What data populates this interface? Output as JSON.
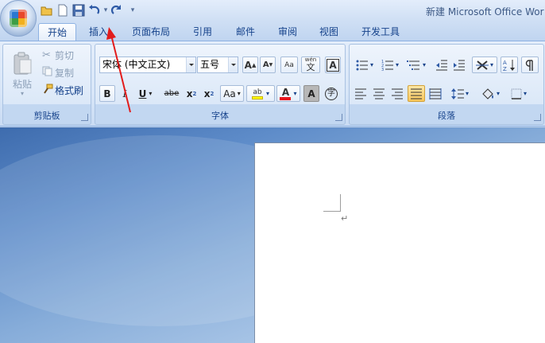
{
  "window": {
    "title": "新建 Microsoft Office Wor"
  },
  "quick_access": {
    "items": [
      "open-folder-icon",
      "new-document-icon",
      "save-icon",
      "undo-icon",
      "redo-icon",
      "customize-icon"
    ]
  },
  "tabs": [
    {
      "label": "开始",
      "active": true
    },
    {
      "label": "插入",
      "active": false
    },
    {
      "label": "页面布局",
      "active": false
    },
    {
      "label": "引用",
      "active": false
    },
    {
      "label": "邮件",
      "active": false
    },
    {
      "label": "审阅",
      "active": false
    },
    {
      "label": "视图",
      "active": false
    },
    {
      "label": "开发工具",
      "active": false
    }
  ],
  "clipboard": {
    "label": "剪贴板",
    "paste": "粘贴",
    "cut": "剪切",
    "copy": "复制",
    "format_painter": "格式刷"
  },
  "font": {
    "label": "字体",
    "font_name": "宋体 (中文正文)",
    "font_size": "五号",
    "bold": "B",
    "italic": "I",
    "underline": "U",
    "strikethrough": "abe",
    "subscript": "x",
    "subscript_mark": "2",
    "superscript": "x",
    "superscript_mark": "2",
    "change_case": "Aa",
    "grow": "A",
    "shrink": "A",
    "clear_format": "Aa",
    "phonetic": "wén",
    "phonetic_char": "文",
    "char_border": "A",
    "highlight_label": "ab",
    "font_color_label": "A",
    "shading_label": "A",
    "enclose_char": "字"
  },
  "paragraph": {
    "label": "段落"
  },
  "colors": {
    "highlight": "#ffff00",
    "font_color": "#e8141b",
    "annotation_arrow": "#e21c1c"
  }
}
